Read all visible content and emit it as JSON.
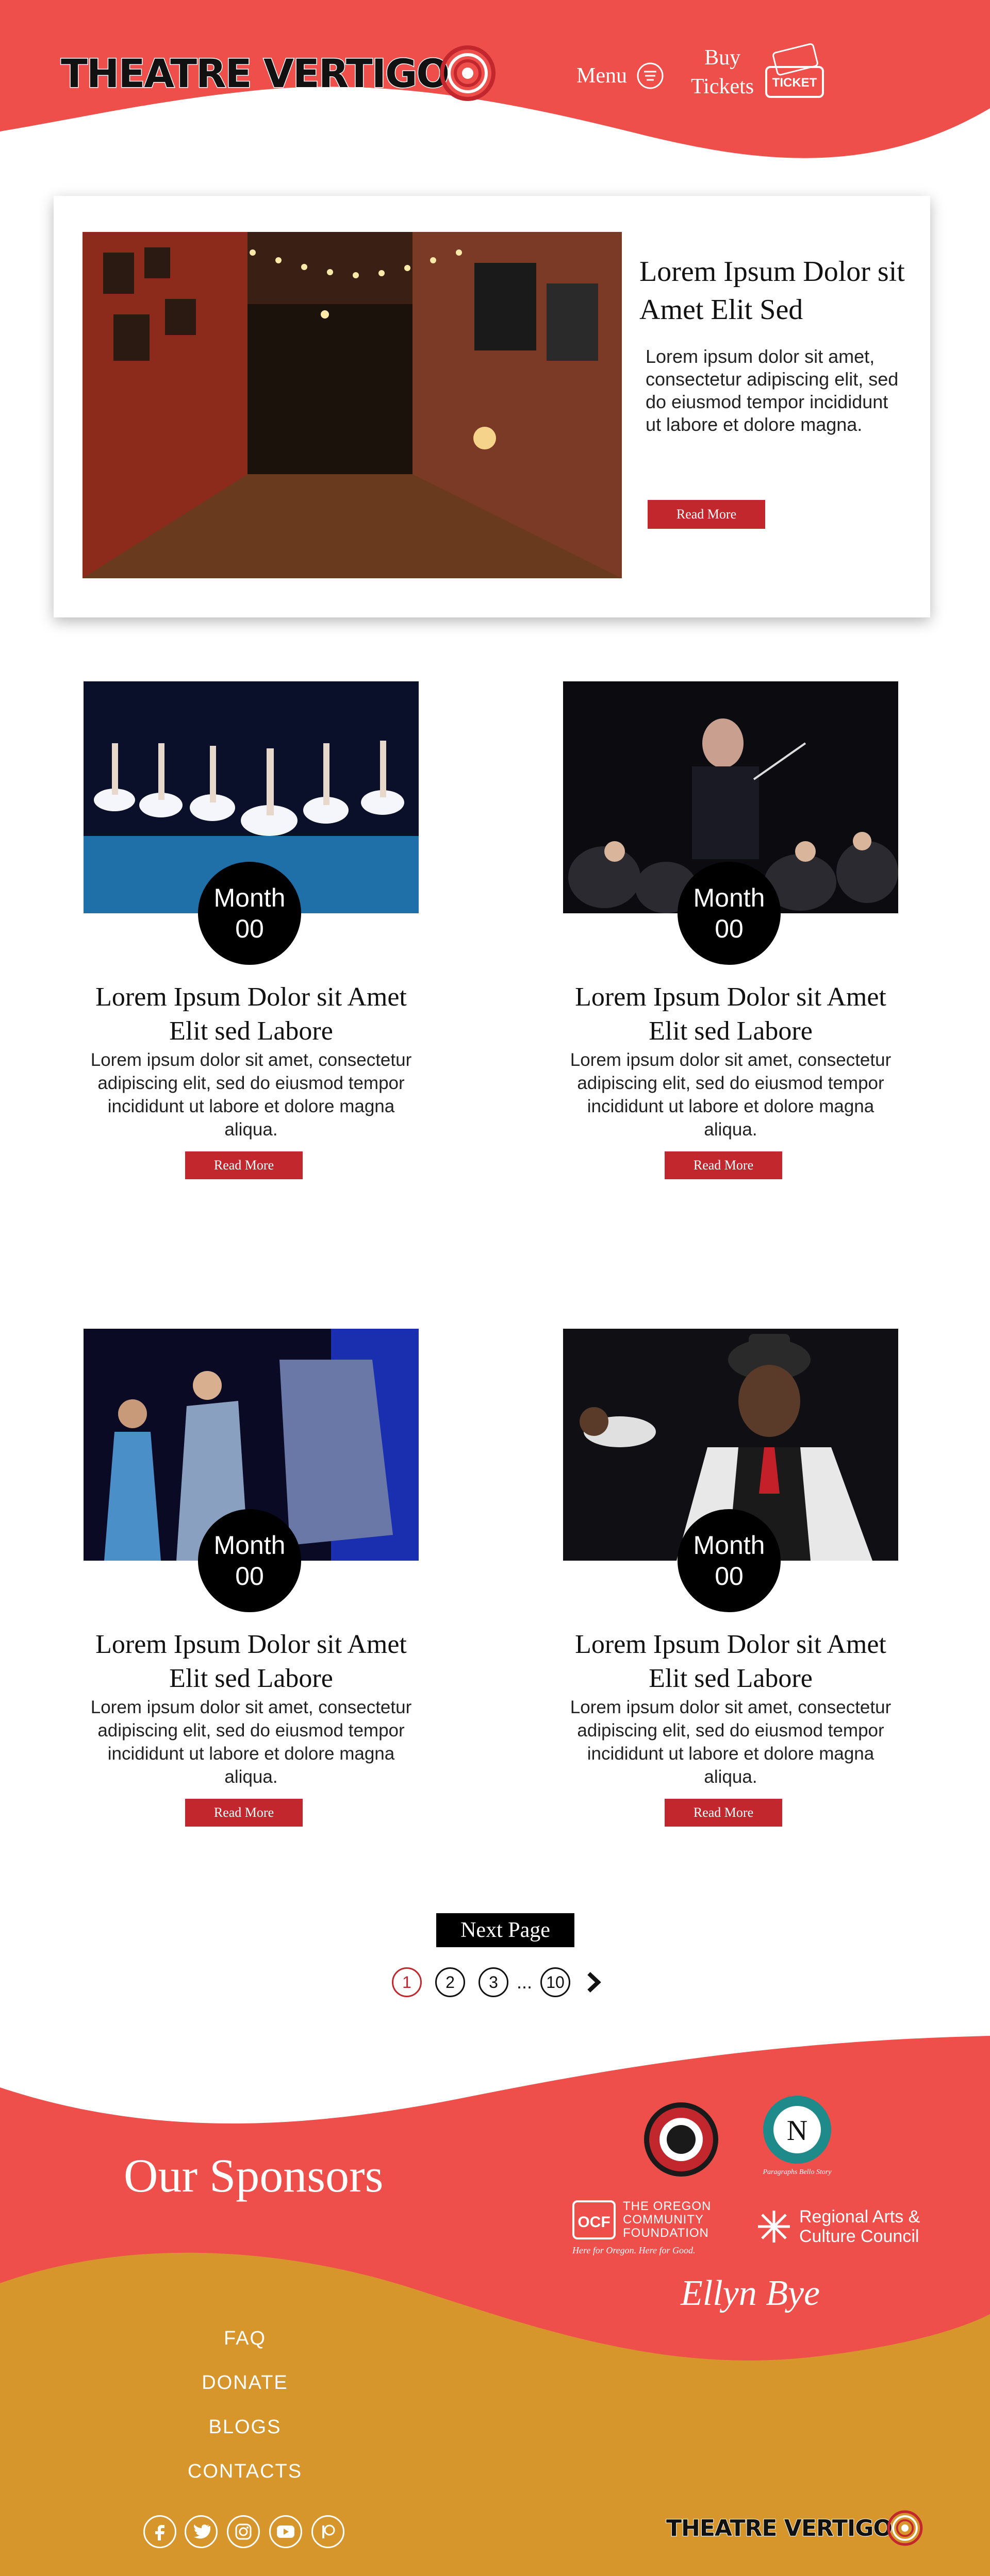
{
  "header": {
    "logo_text": "THEATRE VERTIGO",
    "menu_label": "Menu",
    "tickets_label_line1": "Buy",
    "tickets_label_line2": "Tickets",
    "ticket_icon_text": "TICKET"
  },
  "featured": {
    "title": "Lorem Ipsum Dolor sit Amet Elit Sed",
    "body": "Lorem ipsum dolor sit amet, consectetur adipiscing elit, sed do eiusmod tempor incididunt ut labore et dolore magna.",
    "button": "Read More"
  },
  "events": [
    {
      "month": "Month",
      "day": "00",
      "title": "Lorem Ipsum Dolor sit Amet Elit sed Labore",
      "body": "Lorem ipsum dolor sit amet, consectetur adipiscing elit, sed do eiusmod tempor incididunt ut labore et dolore magna aliqua.",
      "button": "Read More"
    },
    {
      "month": "Month",
      "day": "00",
      "title": "Lorem Ipsum Dolor sit Amet Elit sed Labore",
      "body": "Lorem ipsum dolor sit amet, consectetur adipiscing elit, sed do eiusmod tempor incididunt ut labore et dolore magna aliqua.",
      "button": "Read More"
    },
    {
      "month": "Month",
      "day": "00",
      "title": "Lorem Ipsum Dolor sit Amet Elit sed Labore",
      "body": "Lorem ipsum dolor sit amet, consectetur adipiscing elit, sed do eiusmod tempor incididunt ut labore et dolore magna aliqua.",
      "button": "Read More"
    },
    {
      "month": "Month",
      "day": "00",
      "title": "Lorem Ipsum Dolor sit Amet Elit sed Labore",
      "body": "Lorem ipsum dolor sit amet, consectetur adipiscing elit, sed do eiusmod tempor incididunt ut labore et dolore magna aliqua.",
      "button": "Read More"
    }
  ],
  "pagination": {
    "next_label": "Next Page",
    "pages": [
      "1",
      "2",
      "3",
      "10"
    ],
    "ellipsis": "...",
    "current": "1"
  },
  "footer": {
    "sponsors_title": "Our Sponsors",
    "sponsors": {
      "occ_line1": "THE OREGON",
      "occ_line2": "COMMUNITY",
      "occ_line3": "FOUNDATION",
      "occ_tagline": "Here for Oregon. Here for Good.",
      "racc_line1": "Regional Arts &",
      "racc_line2": "Culture Council",
      "ellyn": "Ellyn Bye",
      "tlg_caption": "Paragraphs Bello Story"
    },
    "links": [
      "FAQ",
      "DONATE",
      "BLOGS",
      "CONTACTS"
    ],
    "social_icons": [
      "facebook-icon",
      "twitter-icon",
      "instagram-icon",
      "youtube-icon",
      "patreon-icon"
    ],
    "logo_text": "THEATRE VERTIGO"
  },
  "colors": {
    "coral": "#ef4f4b",
    "mustard": "#d7962b",
    "button_red": "#c1272d",
    "black": "#000000"
  }
}
